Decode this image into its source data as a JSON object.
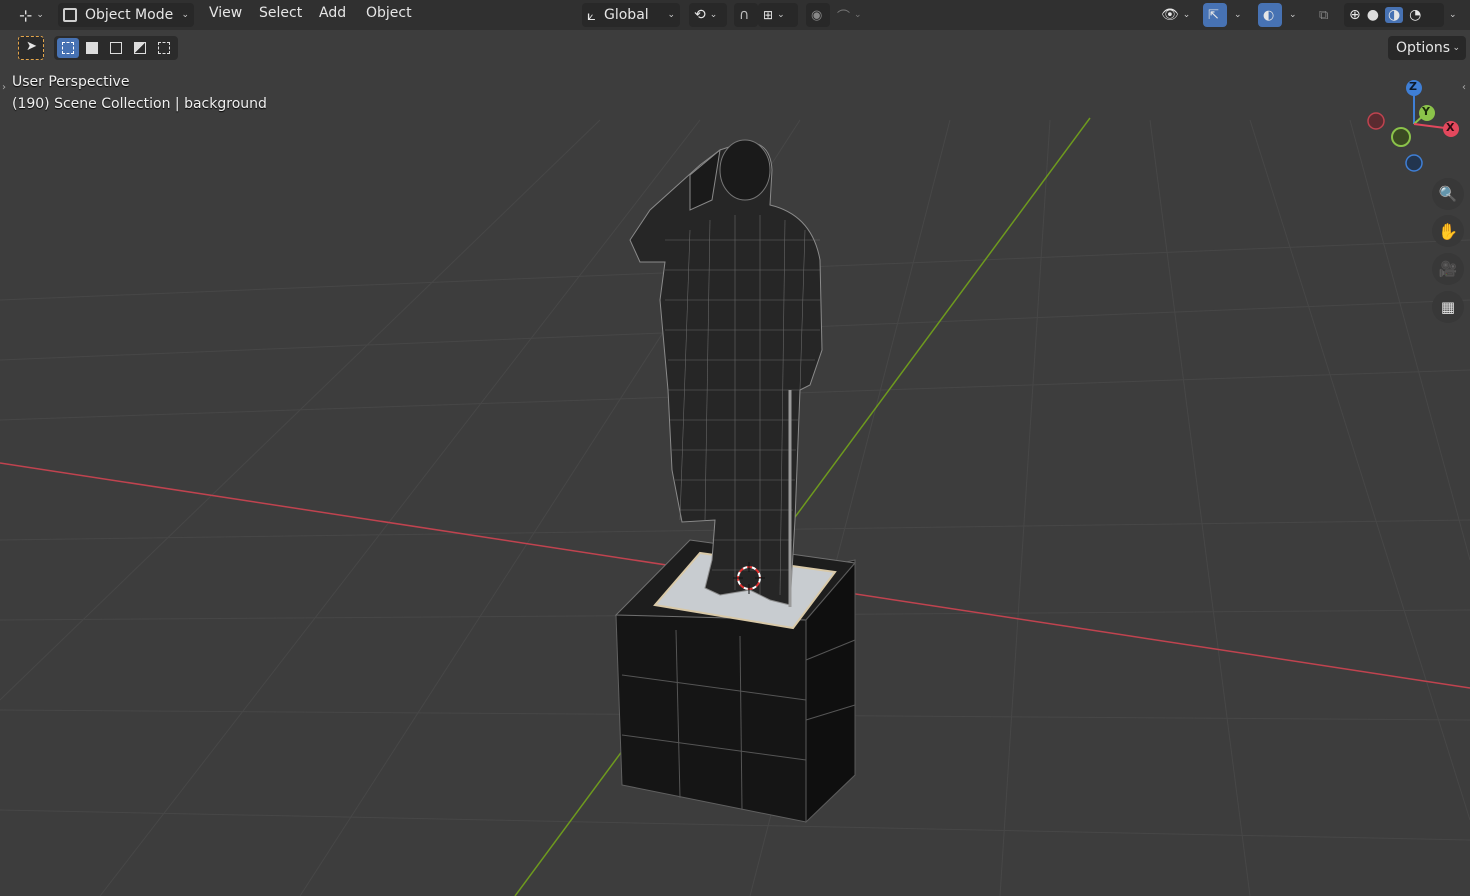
{
  "header": {
    "editor_type_icon": "view3d-icon",
    "mode_label": "Object Mode",
    "menus": [
      "View",
      "Select",
      "Add",
      "Object"
    ],
    "transform_orientation": "Global",
    "pivot_icon": "pivot-icon",
    "snap_icon": "magnet-icon",
    "proportional_icon": "proportional-editing-icon",
    "visibility_icon": "eye-icon",
    "gizmo_icon": "gizmo-icon",
    "overlay_icon": "overlay-icon",
    "xray_icon": "xray-icon",
    "shading_modes": [
      "wireframe",
      "solid",
      "material-preview",
      "rendered"
    ],
    "active_shading": "material-preview"
  },
  "toolbar": {
    "select_tool_icon": "select-box-icon",
    "selection_modes": [
      "set",
      "extend",
      "subtract",
      "invert",
      "intersect"
    ],
    "options_label": "Options"
  },
  "viewport": {
    "perspective_label": "User Perspective",
    "collection_info": "(190) Scene Collection | background"
  },
  "gizmo": {
    "axes": {
      "x": "X",
      "y": "Y",
      "z": "Z"
    },
    "colors": {
      "x": "#e3485d",
      "y": "#8bc34a",
      "z": "#3f7fd6"
    }
  },
  "nav_buttons": [
    "zoom-icon",
    "hand-pan-icon",
    "camera-icon",
    "orthographic-grid-icon"
  ],
  "colors": {
    "background": "#3d3d3d",
    "header": "#303030",
    "accent": "#4772b3",
    "x_axis_line": "#c0434f",
    "y_axis_line": "#6e9a1e"
  }
}
